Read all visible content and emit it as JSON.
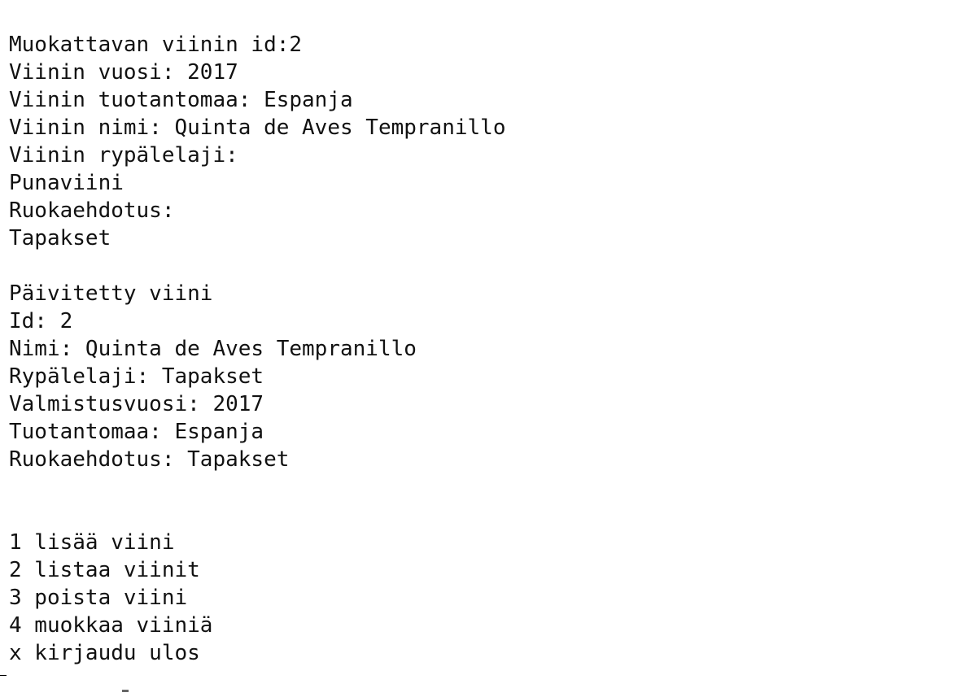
{
  "edit_prompt": {
    "id_line": "Muokattavan viinin id:2",
    "year_line": "Viinin vuosi: 2017",
    "country_line": "Viinin tuotantomaa: Espanja",
    "name_line": "Viinin nimi: Quinta de Aves Tempranillo",
    "grape_label": "Viinin rypälelaji:",
    "grape_value": "Punaviini",
    "food_label": "Ruokaehdotus:",
    "food_value": "Tapakset"
  },
  "updated_wine": {
    "heading": "Päivitetty viini",
    "id_line": "Id: 2",
    "name_line": "Nimi: Quinta de Aves Tempranillo",
    "grape_line": "Rypälelaji: Tapakset",
    "year_line": "Valmistusvuosi: 2017",
    "country_line": "Tuotantomaa: Espanja",
    "food_line": "Ruokaehdotus: Tapakset"
  },
  "menu": {
    "items": [
      "1 lisää viini",
      "2 listaa viinit",
      "3 poista viini",
      "4 muokkaa viiniä",
      "x kirjaudu ulos"
    ]
  }
}
